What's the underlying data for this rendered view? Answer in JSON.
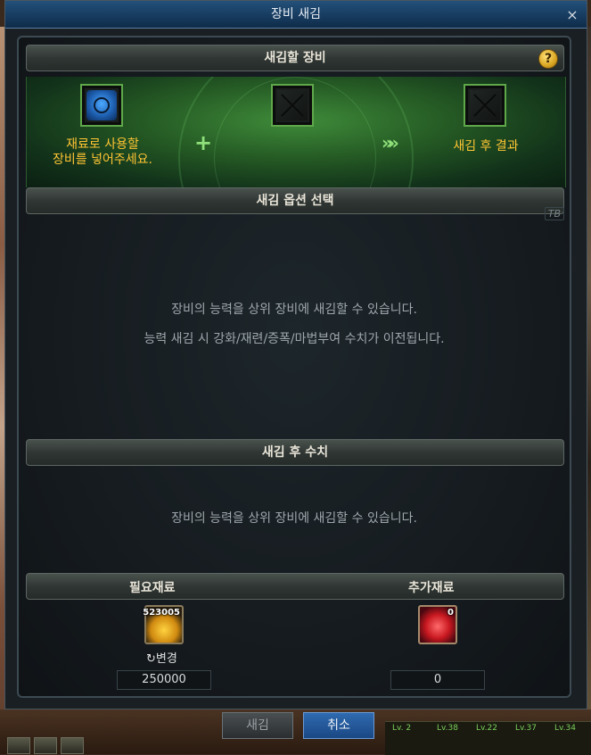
{
  "window": {
    "title": "장비 새김",
    "close_label": "×"
  },
  "equip_section": {
    "header": "새김할 장비",
    "help_label": "?",
    "plus": "+",
    "arrows": "»»",
    "material_slot_label_line1": "재료로 사용할",
    "material_slot_label_line2": "장비를 넣어주세요.",
    "result_slot_label": "새김 후 결과"
  },
  "option_section": {
    "header": "새김 옵션 선택",
    "tag": "TB",
    "line1": "장비의 능력을 상위 장비에 새김할 수 있습니다.",
    "line2": "능력 새김 시 강화/재련/증폭/마법부여 수치가 이전됩니다."
  },
  "result_section": {
    "header": "새김 후 수치",
    "line1": "장비의 능력을 상위 장비에 새김할 수 있습니다."
  },
  "materials": {
    "required_label": "필요재료",
    "additional_label": "추가재료",
    "required_item_count": "523005",
    "additional_item_count": "0",
    "change_label": "↻변경",
    "required_value": "250000",
    "additional_value": "0"
  },
  "buttons": {
    "confirm_label": "새김",
    "cancel_label": "취소"
  },
  "hud": {
    "tags": [
      "Lv. 2",
      "Lv.38",
      "Lv.22",
      "Lv.37",
      "Lv.34"
    ]
  },
  "colors": {
    "title_bar": "#163a5e",
    "accent_gold": "#ffc533",
    "cancel_blue": "#1a4884",
    "slot_border_green": "#5fa84a"
  }
}
